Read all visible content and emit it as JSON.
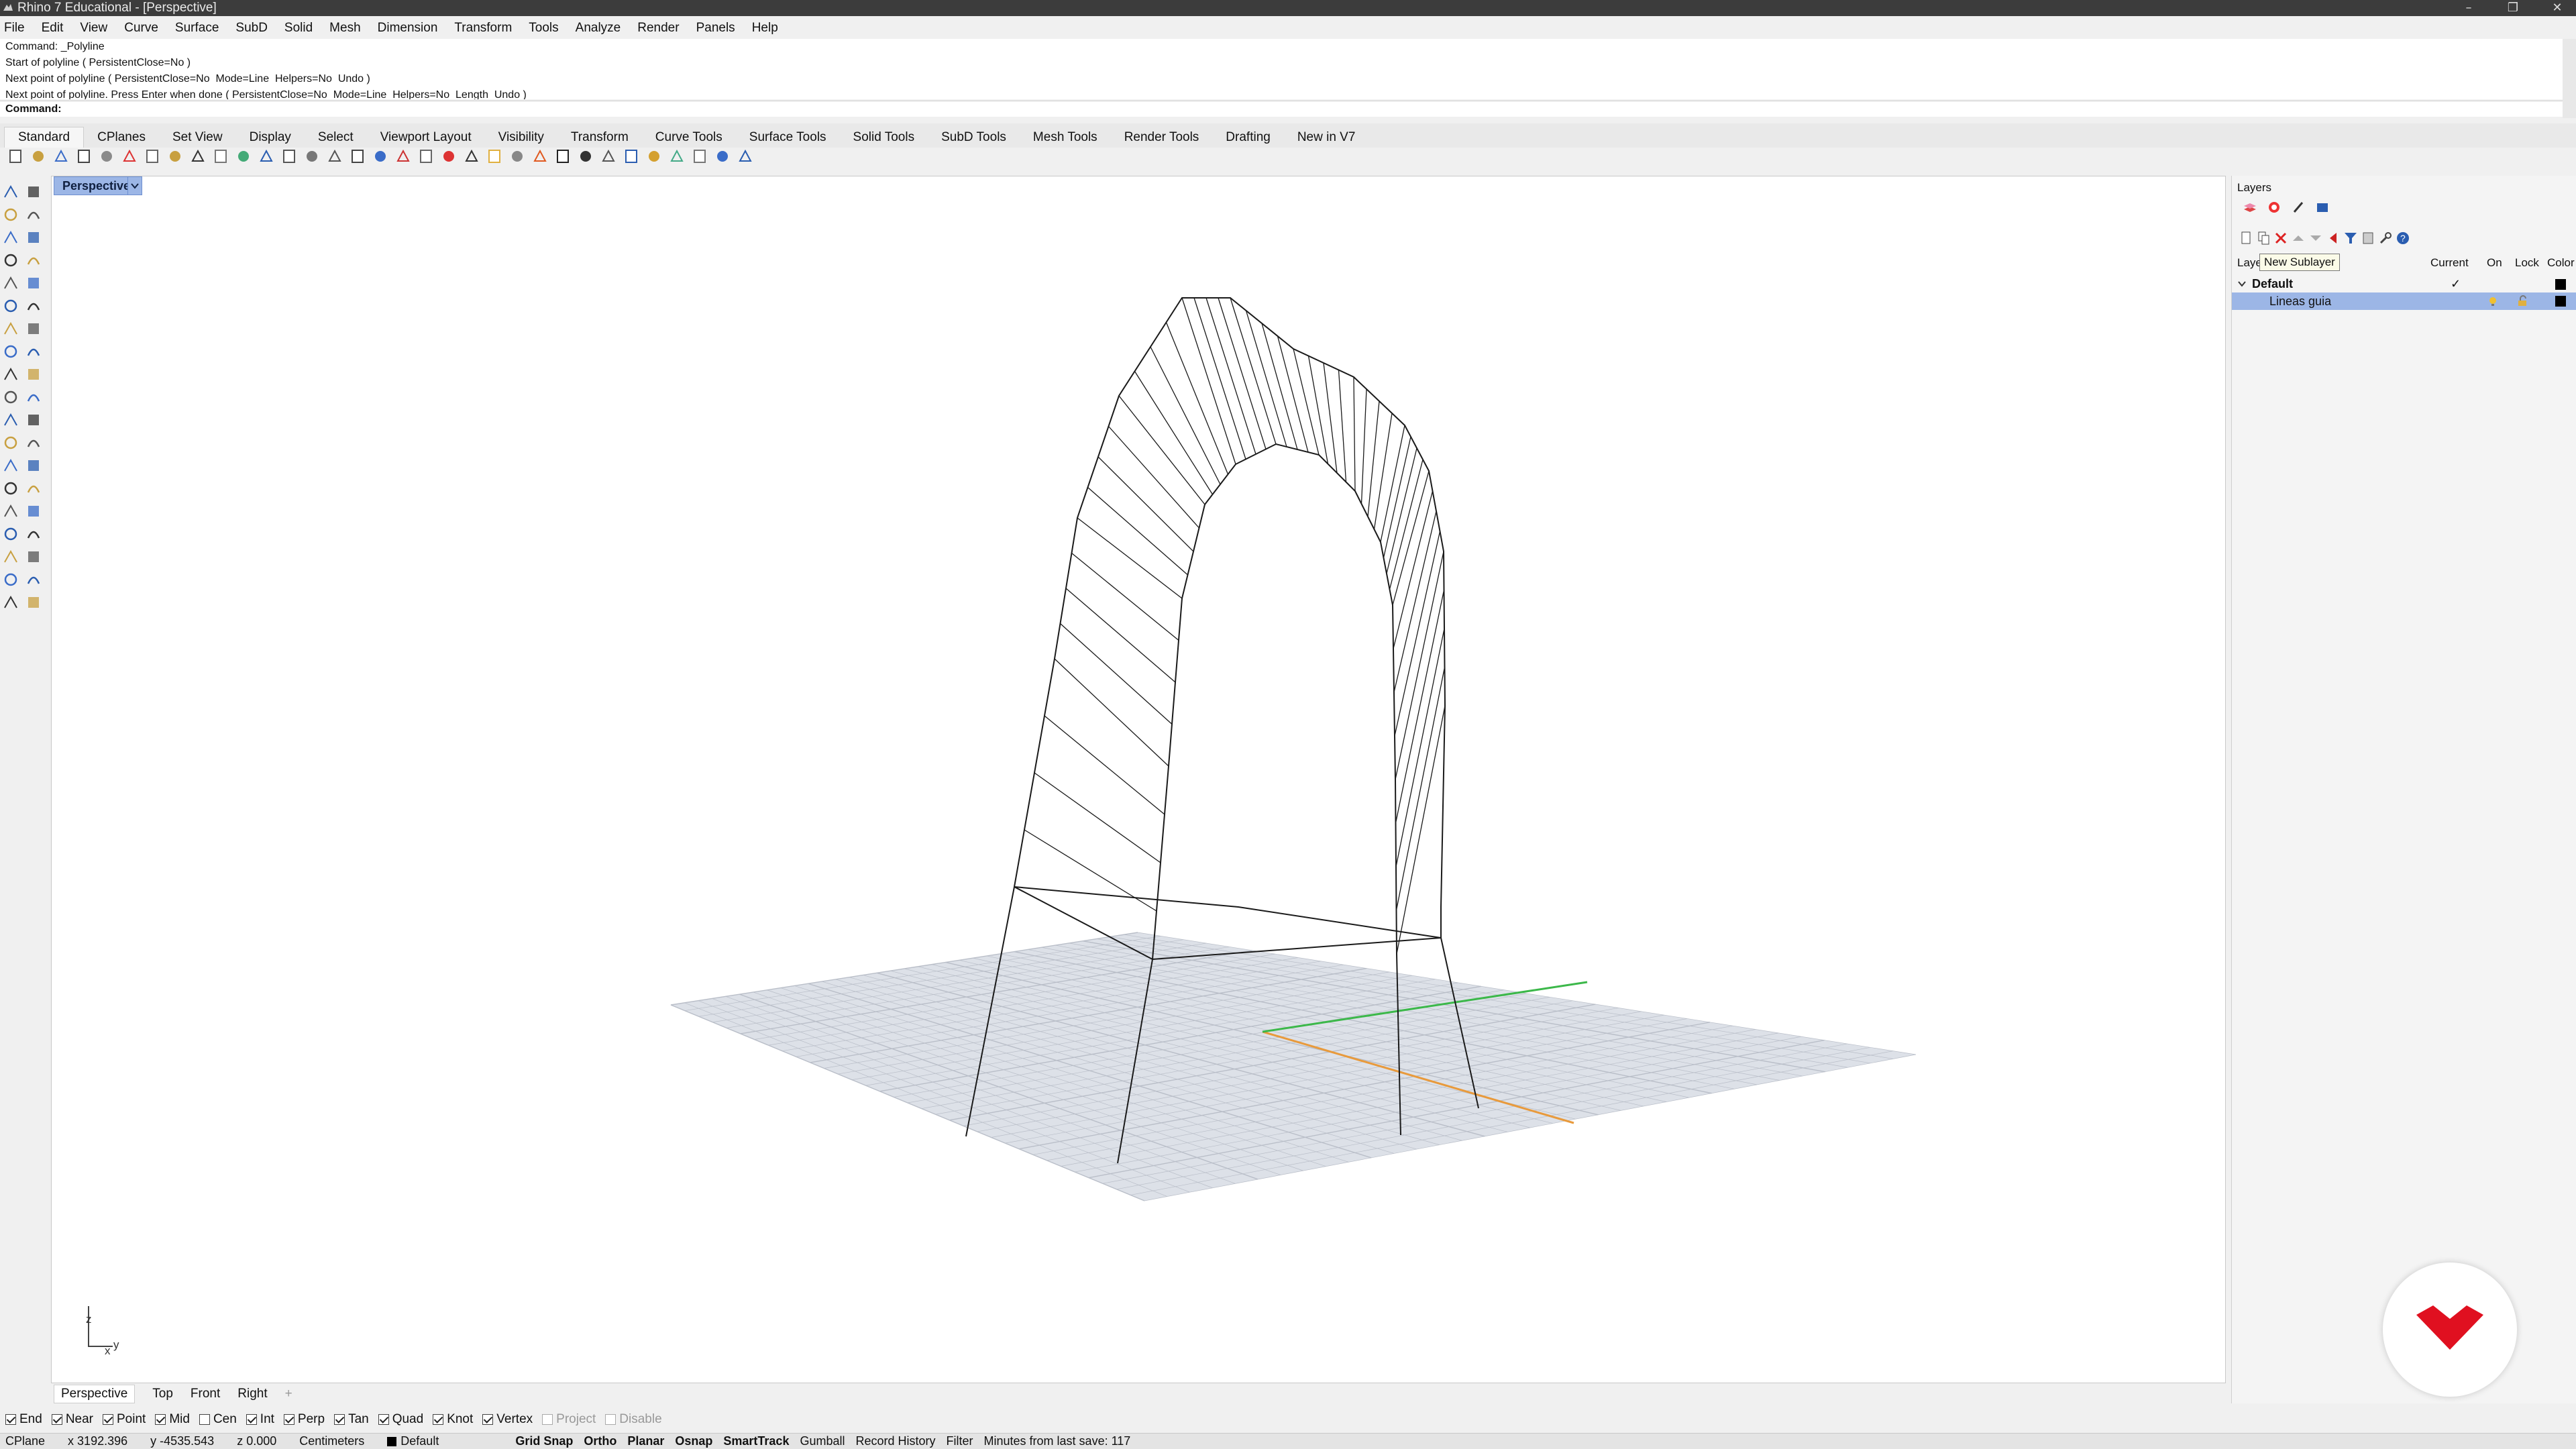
{
  "window": {
    "title": "Rhino 7 Educational - [Perspective]",
    "minimize_glyph": "–",
    "restore_glyph": "❐",
    "close_glyph": "✕"
  },
  "menu": [
    "File",
    "Edit",
    "View",
    "Curve",
    "Surface",
    "SubD",
    "Solid",
    "Mesh",
    "Dimension",
    "Transform",
    "Tools",
    "Analyze",
    "Render",
    "Panels",
    "Help"
  ],
  "command": {
    "history": [
      "Command: _Polyline",
      "Start of polyline ( PersistentClose=No )",
      "Next point of polyline ( PersistentClose=No  Mode=Line  Helpers=No  Undo )",
      "Next point of polyline. Press Enter when done ( PersistentClose=No  Mode=Line  Helpers=No  Length  Undo )"
    ],
    "prompt": "Command:"
  },
  "toolbar_tabs": [
    "Standard",
    "CPlanes",
    "Set View",
    "Display",
    "Select",
    "Viewport Layout",
    "Visibility",
    "Transform",
    "Curve Tools",
    "Surface Tools",
    "Solid Tools",
    "SubD Tools",
    "Mesh Tools",
    "Render Tools",
    "Drafting",
    "New in V7"
  ],
  "toolbar_icons": [
    "new-icon",
    "open-icon",
    "save-icon",
    "print-icon",
    "import-icon",
    "cut-icon",
    "copy-icon",
    "paste-icon",
    "undo-icon",
    "pan-icon",
    "rotate-view-icon",
    "zoom-window-icon",
    "zoom-dynamic-icon",
    "zoom-extents-icon",
    "zoom-selected-icon",
    "undo-view-icon",
    "four-viewports-icon",
    "cplane-icon",
    "grid-icon",
    "line-icon",
    "point-icon",
    "lamp-icon",
    "lock-icon",
    "wireframe-icon",
    "shaded-icon",
    "rendered-icon",
    "ghosted-icon",
    "xray-icon",
    "render-icon",
    "materials-icon",
    "settings-icon",
    "options-icon",
    "help-icon"
  ],
  "viewport": {
    "name": "Perspective",
    "axis_labels": {
      "z": "z",
      "x": "x",
      "y": "y"
    },
    "tabs": [
      "Perspective",
      "Top",
      "Front",
      "Right"
    ],
    "add_tab_glyph": "+"
  },
  "osnaps": [
    {
      "label": "End",
      "checked": true
    },
    {
      "label": "Near",
      "checked": true
    },
    {
      "label": "Point",
      "checked": true
    },
    {
      "label": "Mid",
      "checked": true
    },
    {
      "label": "Cen",
      "checked": false
    },
    {
      "label": "Int",
      "checked": true
    },
    {
      "label": "Perp",
      "checked": true
    },
    {
      "label": "Tan",
      "checked": true
    },
    {
      "label": "Quad",
      "checked": true
    },
    {
      "label": "Knot",
      "checked": true
    },
    {
      "label": "Vertex",
      "checked": true
    },
    {
      "label": "Project",
      "checked": false,
      "disabled": true
    },
    {
      "label": "Disable",
      "checked": false,
      "disabled": true
    }
  ],
  "status": {
    "cplane": "CPlane",
    "x": "x 3192.396",
    "y": "y -4535.543",
    "z": "z 0.000",
    "units": "Centimeters",
    "layer": "Default",
    "toggles_bold": [
      "Grid Snap",
      "Ortho",
      "Planar",
      "Osnap",
      "SmartTrack"
    ],
    "toggles_normal": [
      "Gumball",
      "Record History",
      "Filter"
    ],
    "save_info": "Minutes from last save: 117"
  },
  "layers_panel": {
    "title": "Layers",
    "header": {
      "name": "Layer",
      "current": "Current",
      "on": "On",
      "lock": "Lock",
      "color": "Color"
    },
    "tooltip": "New Sublayer",
    "rows": [
      {
        "name": "Default",
        "current_mark": "✓",
        "color": "#000000",
        "expanded": true
      },
      {
        "name": "Lineas guia",
        "color": "#000000",
        "selected": true
      }
    ]
  },
  "colors": {
    "viewport_label_bg": "#9cb6e6",
    "selected_row_bg": "#9cb6e6",
    "x_axis": "#e89a3c",
    "y_axis": "#3cb84a",
    "grid_plane": "#dde1e8",
    "grid_lines": "#b9bec8",
    "wire": "#1a1a1a",
    "logo_red": "#e01020"
  }
}
